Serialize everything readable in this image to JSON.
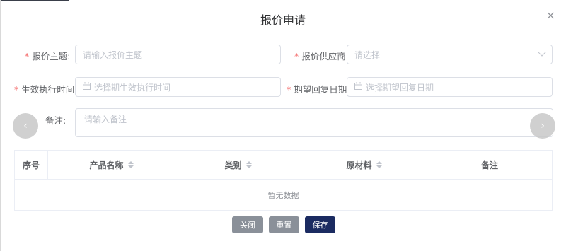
{
  "dialog": {
    "title": "报价申请",
    "close_symbol": "×"
  },
  "form": {
    "subject": {
      "label": "报价主题:",
      "placeholder": "请输入报价主题"
    },
    "supplier": {
      "label": "报价供应商:",
      "placeholder": "请选择"
    },
    "effective_time": {
      "label": "生效执行时间:",
      "placeholder": "选择期生效执行时间"
    },
    "reply_date": {
      "label": "期望回复日期:",
      "placeholder": "选择期望回复日期"
    },
    "remark": {
      "label": "备注:",
      "placeholder": "请输入备注"
    },
    "required_mark": "*"
  },
  "carousel": {
    "prev_symbol": "‹",
    "next_symbol": "›"
  },
  "table": {
    "columns": [
      "序号",
      "产品名称",
      "类别",
      "原材料",
      "备注"
    ],
    "empty_text": "暂无数据"
  },
  "footer": {
    "close_label": "关闭",
    "reset_label": "重置",
    "save_label": "保存"
  },
  "icons": [
    "calendar-icon",
    "chevron-down-icon",
    "close-icon",
    "sort-icon"
  ],
  "colors": {
    "primary": "#1b2b61",
    "secondary_btn": "#8a9099",
    "required": "#f56c6c"
  }
}
